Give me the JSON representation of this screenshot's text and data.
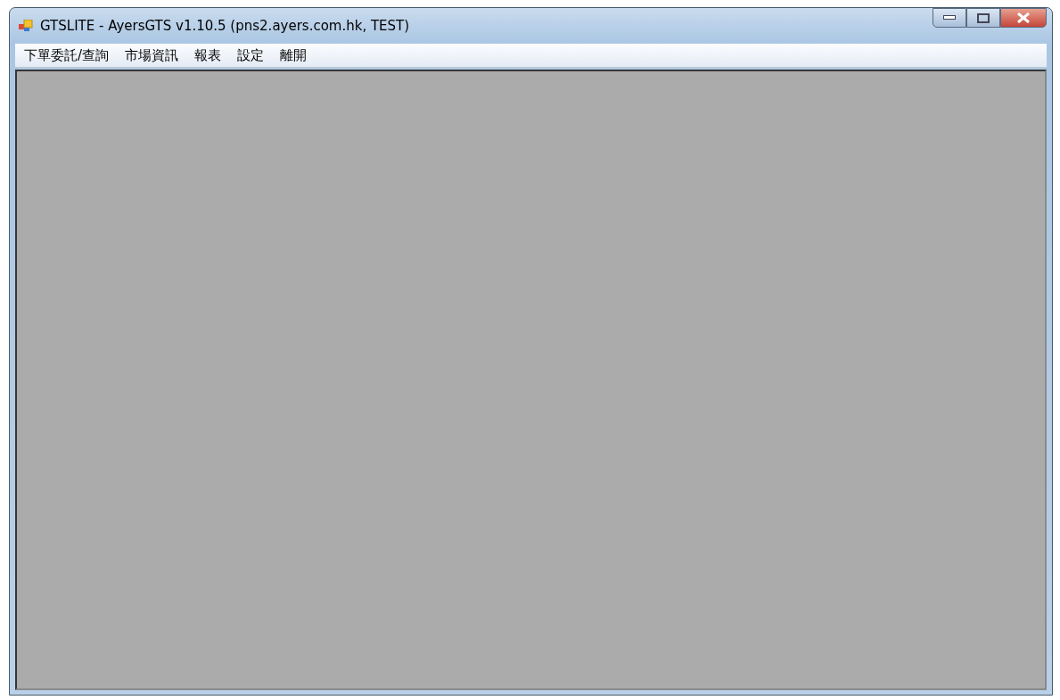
{
  "window": {
    "title": "GTSLITE - AyersGTS v1.10.5 (pns2.ayers.com.hk, TEST)"
  },
  "menu": [
    {
      "label": "下單委託/查詢"
    },
    {
      "label": "市場資訊"
    },
    {
      "label": "報表"
    },
    {
      "label": "設定"
    },
    {
      "label": "離開"
    }
  ]
}
